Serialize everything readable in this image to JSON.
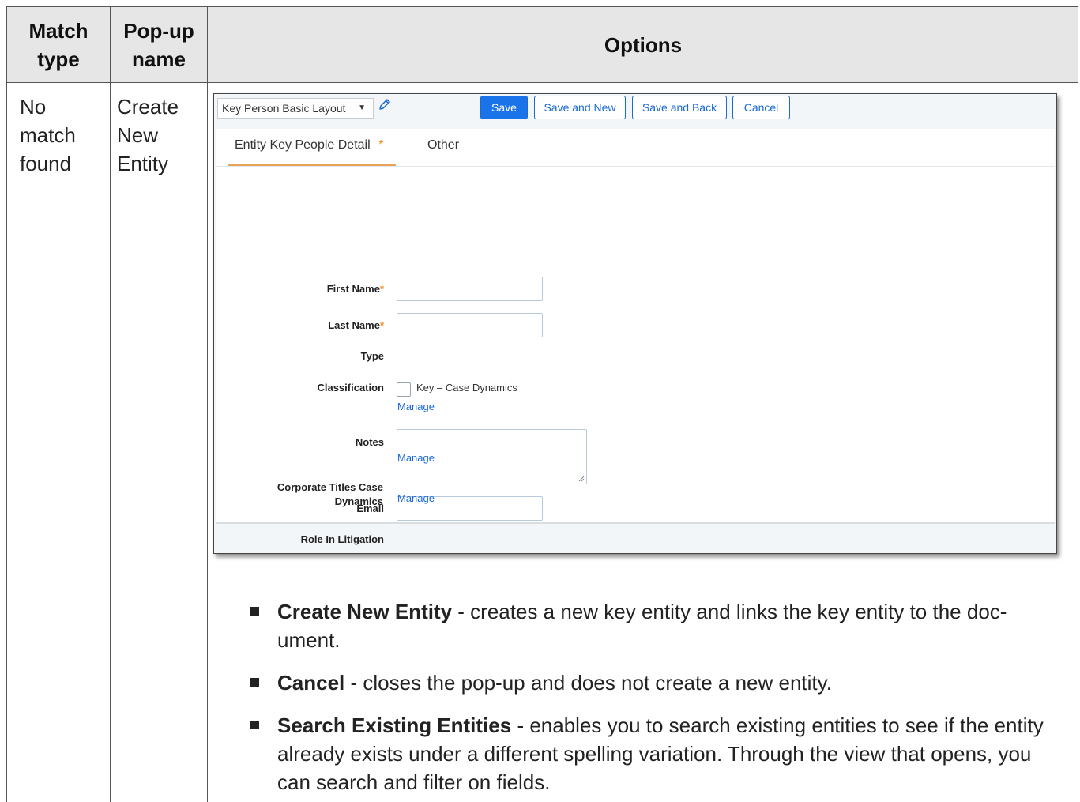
{
  "table": {
    "headers": [
      "Match type",
      "Pop-up name",
      "Options"
    ],
    "match_type": "No match found",
    "popup_name": "Create New Entity"
  },
  "screenshot": {
    "layout_select": "Key Person Basic Layout",
    "buttons": {
      "save": "Save",
      "save_and_new": "Save and New",
      "save_and_back": "Save and Back",
      "cancel": "Cancel"
    },
    "tabs": {
      "detail": "Entity Key People Detail",
      "detail_required": "*",
      "other": "Other"
    },
    "fields": {
      "first_name": "First Name",
      "last_name": "Last Name",
      "required_mark": "*",
      "type": "Type",
      "classification": "Classification",
      "classification_option": "Key – Case Dynamics",
      "manage": "Manage",
      "notes": "Notes",
      "email": "Email",
      "role_in_litigation": "Role In Litigation",
      "corporate_titles_1": "Corporate Titles Case",
      "corporate_titles_2": "Dynamics"
    }
  },
  "bullets": [
    {
      "term": "Create New Entity",
      "text": " - creates a new key entity and links the key entity to the doc-ument."
    },
    {
      "term": "Cancel",
      "text": " - closes the pop-up and does not create a new entity."
    },
    {
      "term": "Search Existing Entities",
      "text": " - enables you to search existing entities to see if the entity already exists under a different spelling variation. Through the view that opens, you can search and filter on fields."
    }
  ],
  "colors": {
    "header_bg": "#e6e6e6",
    "primary_button": "#1a73e8",
    "link": "#1a6ad6",
    "required": "#f28a1b"
  }
}
